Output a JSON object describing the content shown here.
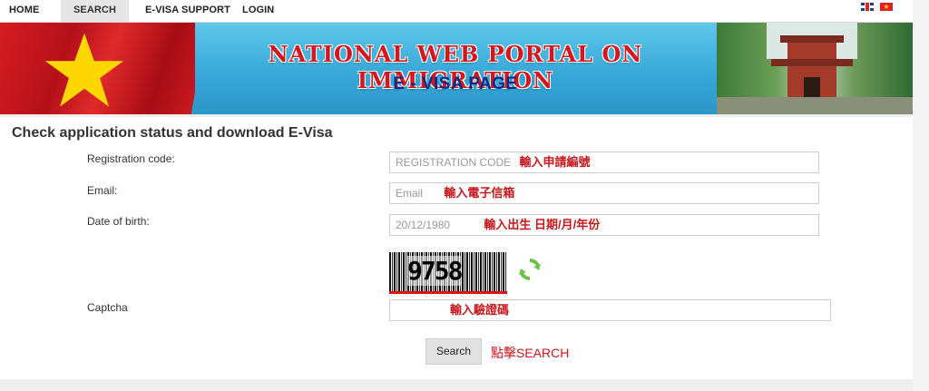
{
  "nav": {
    "items": [
      "HOME",
      "SEARCH",
      "E-VISA SUPPORT",
      "LOGIN"
    ],
    "active": "SEARCH",
    "flags": [
      "uk-flag",
      "vietnam-flag"
    ]
  },
  "banner": {
    "title": "NATIONAL WEB PORTAL ON IMMIGRATION",
    "subtitle": "E - VISA PAGE"
  },
  "form": {
    "heading": "Check application status and download E-Visa",
    "registration": {
      "label": "Registration code:",
      "placeholder": "REGISTRATION CODE",
      "annotation": "輸入申請編號"
    },
    "email": {
      "label": "Email:",
      "placeholder": "Email",
      "annotation": "輸入電子信箱"
    },
    "dob": {
      "label": "Date of birth:",
      "placeholder": "20/12/1980",
      "annotation": "輸入出生 日期/月/年份"
    },
    "captcha": {
      "label": "Captcha",
      "image_text": "9758",
      "annotation": "輸入驗證碼"
    },
    "search_button": "Search",
    "search_annotation": "點擊SEARCH"
  },
  "colors": {
    "annotation_red": "#c8161d",
    "banner_blue": "#37a9d8",
    "title_red": "#d4171e",
    "subtitle_navy": "#0f2a86"
  }
}
